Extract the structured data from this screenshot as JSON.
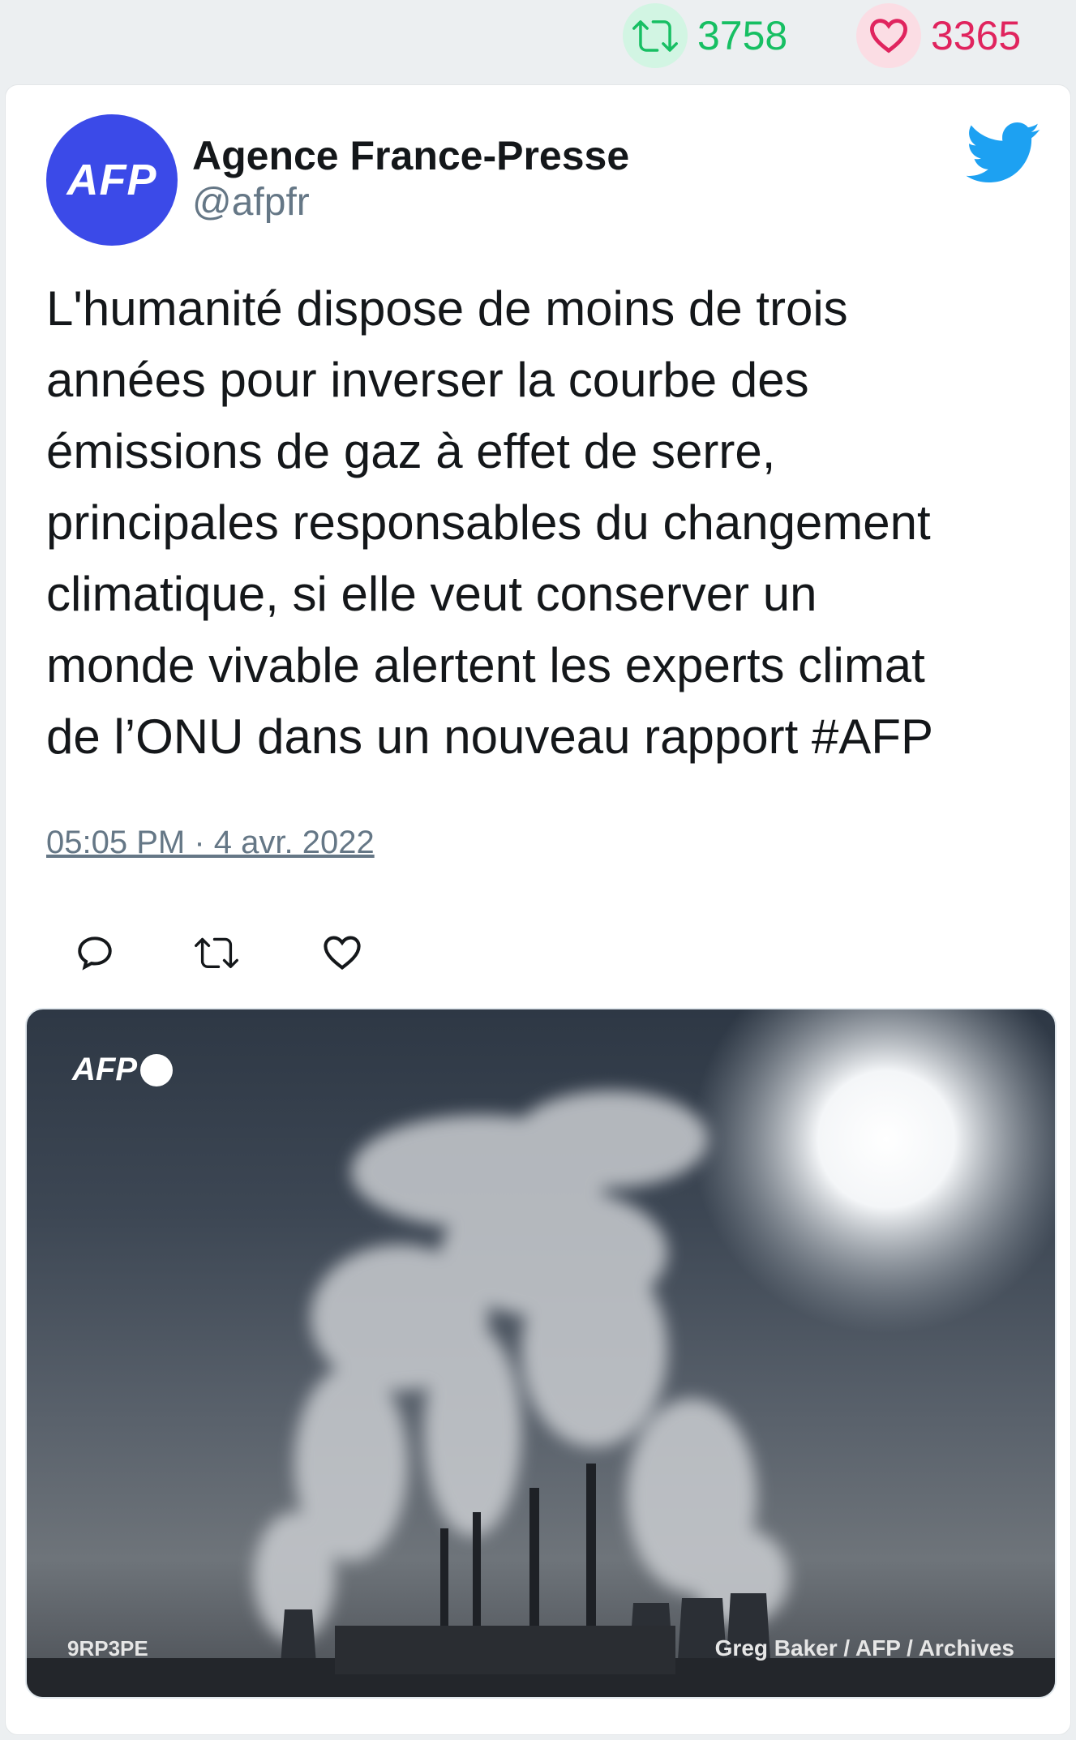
{
  "stats": {
    "retweet_count": "3758",
    "like_count": "3365"
  },
  "tweet": {
    "author_name": "Agence France-Presse",
    "handle": "@afpfr",
    "avatar_text": "AFP",
    "text": "L'humanité dispose de moins de trois\nannées pour inverser la courbe des\némissions de gaz à effet de serre,\nprincipales responsables du changement\nclimatique, si elle veut conserver un\nmonde vivable alertent les experts climat\nde l’ONU dans un nouveau rapport #AFP",
    "timestamp": "05:05 PM · 4 avr. 2022"
  },
  "media": {
    "watermark": "AFP",
    "photo_code": "9RP3PE",
    "credit": "Greg Baker / AFP / Archives"
  },
  "icons": {
    "retweet": "retweet-icon",
    "like": "heart-icon",
    "reply": "reply-icon",
    "brand": "twitter-bird-icon"
  },
  "colors": {
    "retweet": "#17bf63",
    "like": "#e0245e",
    "twitter_blue": "#1da1f2",
    "avatar": "#3b4ae8"
  }
}
